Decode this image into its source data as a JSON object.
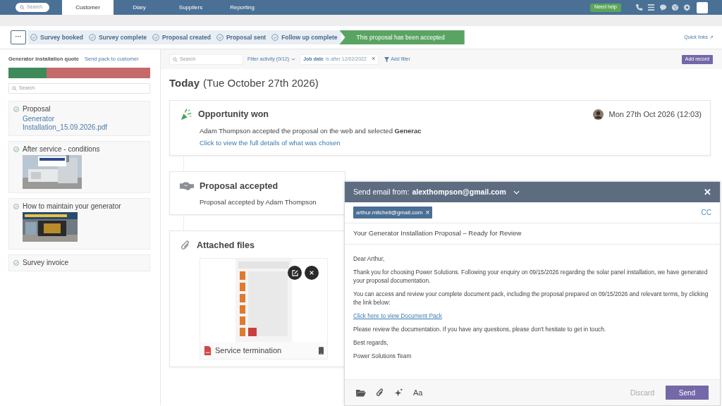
{
  "nav": {
    "search_placeholder": "Search",
    "tabs": [
      {
        "label": "Customer",
        "selected": true
      },
      {
        "label": "Diary",
        "selected": false
      },
      {
        "label": "Suppliers",
        "selected": false
      },
      {
        "label": "Reporting",
        "selected": false
      }
    ],
    "help": "Need help"
  },
  "steps": {
    "more": "···",
    "items": [
      {
        "label": "Survey booked",
        "selected": false
      },
      {
        "label": "Survey complete",
        "selected": false
      },
      {
        "label": "Proposal created",
        "selected": false
      },
      {
        "label": "Proposal sent",
        "selected": false
      },
      {
        "label": "Follow up complete",
        "selected": false
      },
      {
        "label": "This proposal has been accepted",
        "selected": true
      }
    ],
    "quick_links": "Quick links ↗"
  },
  "sidebar": {
    "title": "Generator installation quote",
    "action": "Send pack to customer",
    "level": 0.27,
    "search_placeholder": "Search",
    "items": [
      {
        "kind": "file",
        "title": "Proposal",
        "link": "Generator Installation_15.09.2026.pdf"
      },
      {
        "title": "After service - conditions"
      },
      {
        "title": "How to maintain your generator"
      },
      {
        "kind": "plain",
        "title": "Survey invoice"
      }
    ]
  },
  "toolbar": {
    "search_placeholder": "Search",
    "filter": "Filter activity (0/12)",
    "chip_label": "Job date",
    "chip_text": "is after 12/02/2022",
    "chip_close": "×",
    "add_filter": "Add filter",
    "add_record": "Add record"
  },
  "day": {
    "title": "Today",
    "subtitle": "(Tue October 27th 2026)"
  },
  "cards": [
    {
      "kind": "won",
      "title": "Opportunity won",
      "time": "Mon 27th Oct 2026 (12:03)",
      "text": "Adam Thompson accepted the proposal on the web and selected  **Generac**",
      "link": "Click to view the full details of what was chosen"
    },
    {
      "kind": "accepted",
      "title": "Proposal accepted",
      "text": "Proposal accepted by Adam Thompson"
    },
    {
      "kind": "files",
      "title": "Attached files",
      "file": "Service termination"
    }
  ],
  "email": {
    "from_label": "Send email from:",
    "from": "alexthompson@gmail.com",
    "close": "✕",
    "to": "arthur.mitchell@gmail.com",
    "to_remove": "×",
    "cc": "CC",
    "subject": "Your Generator Installation Proposal – Ready for Review",
    "body": [
      {
        "kind": "text",
        "text": "Dear Arthur,"
      },
      {
        "kind": "text",
        "text": "Thank you for choosing Power Solutions. Following your enquiry on 09/15/2026 regarding the solar panel installation, we have generated your proposal documentation."
      },
      {
        "kind": "text",
        "text": "You can access and review your complete document pack, including the proposal prepared on 09/15/2026 and relevant terms, by clicking the link below:"
      },
      {
        "kind": "link",
        "text": "Click here to view Document Pack"
      },
      {
        "kind": "text",
        "text": "Please review the documentation. If you have any questions, please don't hesitate to get in touch."
      },
      {
        "kind": "text",
        "text": "Best regards,"
      },
      {
        "kind": "text",
        "text": "Power Solutions Team"
      }
    ],
    "font_button": "Aa",
    "discard": "Discard",
    "send": "Send"
  }
}
